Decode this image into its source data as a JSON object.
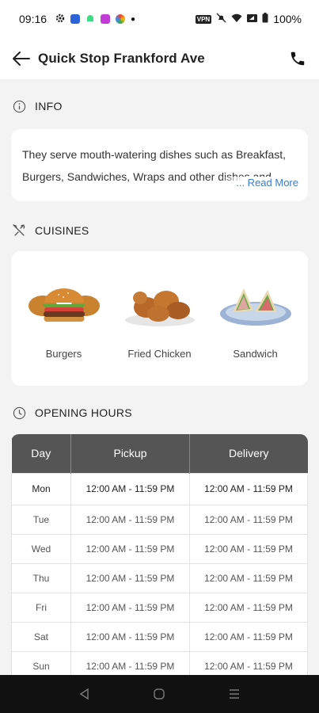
{
  "status_bar": {
    "time": "09:16",
    "battery": "100%",
    "vpn_label": "VPN"
  },
  "header": {
    "title": "Quick Stop Frankford Ave"
  },
  "info": {
    "heading": "INFO",
    "text": "They serve mouth-watering dishes such as Breakfast, Burgers, Sandwiches, Wraps and other dishes and more.",
    "read_more": "... Read More"
  },
  "cuisines": {
    "heading": "CUISINES",
    "items": [
      {
        "label": "Burgers",
        "icon": "burger-image"
      },
      {
        "label": "Fried Chicken",
        "icon": "fried-chicken-image"
      },
      {
        "label": "Sandwich",
        "icon": "sandwich-image"
      }
    ]
  },
  "opening_hours": {
    "heading": "OPENING HOURS",
    "columns": [
      "Day",
      "Pickup",
      "Delivery"
    ],
    "rows": [
      {
        "day": "Mon",
        "pickup": "12:00 AM - 11:59 PM",
        "delivery": "12:00 AM - 11:59 PM"
      },
      {
        "day": "Tue",
        "pickup": "12:00 AM - 11:59 PM",
        "delivery": "12:00 AM - 11:59 PM"
      },
      {
        "day": "Wed",
        "pickup": "12:00 AM - 11:59 PM",
        "delivery": "12:00 AM - 11:59 PM"
      },
      {
        "day": "Thu",
        "pickup": "12:00 AM - 11:59 PM",
        "delivery": "12:00 AM - 11:59 PM"
      },
      {
        "day": "Fri",
        "pickup": "12:00 AM - 11:59 PM",
        "delivery": "12:00 AM - 11:59 PM"
      },
      {
        "day": "Sat",
        "pickup": "12:00 AM - 11:59 PM",
        "delivery": "12:00 AM - 11:59 PM"
      },
      {
        "day": "Sun",
        "pickup": "12:00 AM - 11:59 PM",
        "delivery": "12:00 AM - 11:59 PM"
      }
    ]
  },
  "colors": {
    "table_header": "#555555",
    "link": "#3f7cc7",
    "background": "#f3f3f3"
  }
}
